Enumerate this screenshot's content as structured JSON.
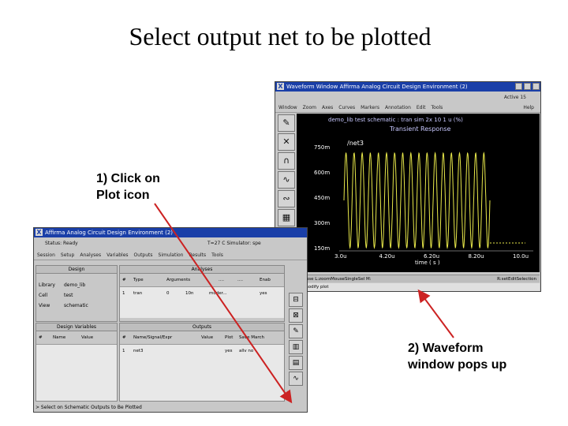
{
  "slide": {
    "title": "Select output net to be plotted",
    "callout1": [
      "1) Click on",
      "Plot icon"
    ],
    "callout2": [
      "2) Waveform",
      "window pops up"
    ]
  },
  "waveform_window": {
    "title": "Waveform Window   Affirma Analog Circuit Design Environment (2)",
    "status": "Active  15",
    "menus": [
      "Window",
      "Zoom",
      "Axes",
      "Curves",
      "Markers",
      "Annotation",
      "Edit",
      "Tools"
    ],
    "help": "Help",
    "plot_header": "demo_lib test schematic : tran sim 2x 10 1  u (%)",
    "plot_title": "Transient Response",
    "trace_label": "/net3",
    "y_ticks": [
      "750m",
      "600m",
      "450m",
      "300m",
      "150m"
    ],
    "x_ticks": [
      "3.0u",
      "4.20u",
      "6.20u",
      "8.20u",
      "10.0u"
    ],
    "x_label": "time ( s )",
    "bottom_left": "mouse L:zoomMouseSingleSel M:",
    "bottom_right": "R:setEditSelection",
    "cmd": "> modify plot",
    "accent": "#1a3fa8",
    "trace_color": "#e8e84a"
  },
  "ade_window": {
    "title": "Affirma Analog Circuit Design Environment (2)",
    "status_left": "Status: Ready",
    "status_right": "T=27 C  Simulator: spe",
    "menus": [
      "Session",
      "Setup",
      "Analyses",
      "Variables",
      "Outputs",
      "Simulation",
      "Results",
      "Tools"
    ],
    "design_header": "Design",
    "analyses_header": "Analyses",
    "library_label": "Library",
    "library_value": "demo_lib",
    "cell_label": "Cell",
    "cell_value": "test",
    "view_label": "View",
    "view_value": "schematic",
    "analyses_cols": [
      "#",
      "Type",
      "Arguments",
      "....",
      "....",
      "Enab"
    ],
    "analyses_row": [
      "1",
      "tran",
      "0",
      "10n",
      "moder...",
      "yes"
    ],
    "design_vars_header": "Design Variables",
    "design_vars_cols": [
      "#",
      "Name",
      "Value"
    ],
    "outputs_header": "Outputs",
    "outputs_cols": [
      "#",
      "Name/Signal/Expr",
      "Value",
      "Plot",
      "Save March"
    ],
    "outputs_row": [
      "1",
      "net3",
      "",
      "yes",
      "allv no"
    ],
    "status_bottom": "> Select on Schematic Outputs to Be Plotted"
  }
}
